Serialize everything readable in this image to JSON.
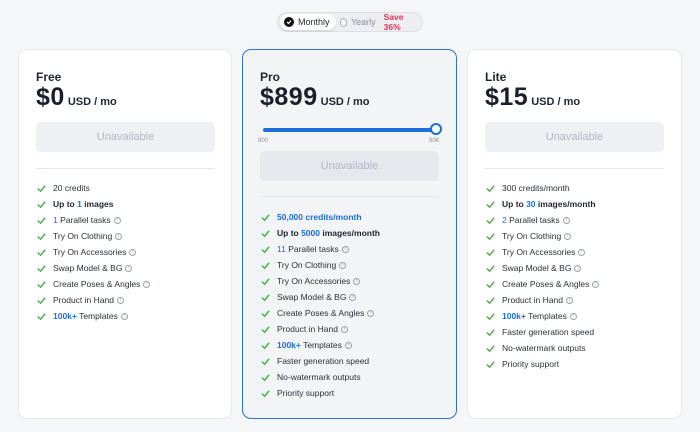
{
  "billing_toggle": {
    "monthly_label": "Monthly",
    "yearly_label": "Yearly",
    "save_badge": "Save 36%",
    "selected": "Monthly"
  },
  "colors": {
    "accent": "#1a6fd8",
    "check": "#3aaa3a",
    "save": "#e8305a",
    "highlight_border": "#2f6fd0"
  },
  "plans": {
    "free": {
      "name": "Free",
      "price": "$0",
      "unit": "USD / mo",
      "button": "Unavailable",
      "features": {
        "f1": "20 credits",
        "f2_prefix": "Up to ",
        "f2_num": "1",
        "f2_suffix": " images",
        "f3_num": "1",
        "f3_suffix": " Parallel tasks",
        "f4": "Try On Clothing",
        "f5": "Try On Accessories",
        "f6": "Swap Model & BG",
        "f7": "Create Poses & Angles",
        "f8": "Product in Hand",
        "f9_num": "100k+",
        "f9_suffix": " Templates"
      }
    },
    "pro": {
      "name": "Pro",
      "price": "$899",
      "unit": "USD / mo",
      "slider_min": "800",
      "slider_max": "50K",
      "slider_fraction": 1.0,
      "button": "Unavailable",
      "features": {
        "f1": "50,000 credits/month",
        "f2_prefix": "Up to ",
        "f2_num": "5000",
        "f2_suffix": " images/month",
        "f3_num": "11",
        "f3_suffix": " Parallel tasks",
        "f4": "Try On Clothing",
        "f5": "Try On Accessories",
        "f6": "Swap Model & BG",
        "f7": "Create Poses & Angles",
        "f8": "Product in Hand",
        "f9_num": "100k+",
        "f9_suffix": " Templates",
        "f10": "Faster generation speed",
        "f11": "No-watermark outputs",
        "f12": "Priority support"
      }
    },
    "lite": {
      "name": "Lite",
      "price": "$15",
      "unit": "USD / mo",
      "button": "Unavailable",
      "features": {
        "f1": "300 credits/month",
        "f2_prefix": "Up to ",
        "f2_num": "30",
        "f2_suffix": " images/month",
        "f3_num": "2",
        "f3_suffix": " Parallel tasks",
        "f4": "Try On Clothing",
        "f5": "Try On Accessories",
        "f6": "Swap Model & BG",
        "f7": "Create Poses & Angles",
        "f8": "Product in Hand",
        "f9_num": "100k+",
        "f9_suffix": " Templates",
        "f10": "Faster generation speed",
        "f11": "No-watermark outputs",
        "f12": "Priority support"
      }
    }
  }
}
